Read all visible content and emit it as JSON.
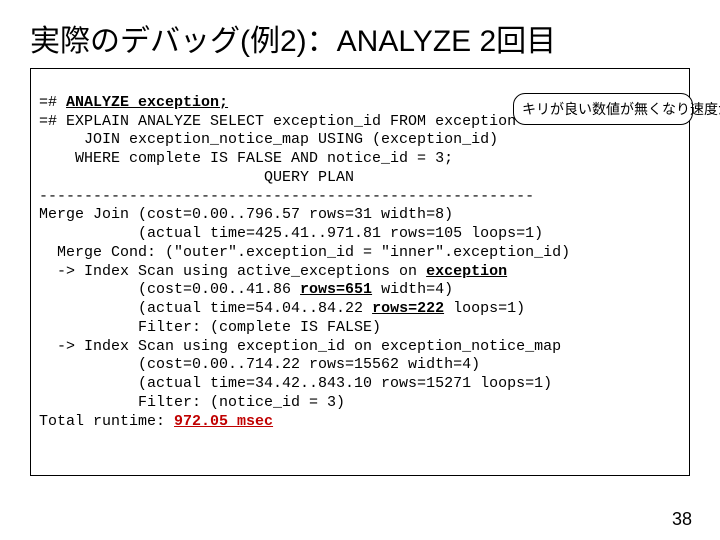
{
  "title": "実際のデバッグ(例2)：ANALYZE 2回目",
  "code": {
    "l1a": "=# ",
    "l1b": "ANALYZE exception;",
    "l2": "=# EXPLAIN ANALYZE SELECT exception_id FROM exception",
    "l3": "     JOIN exception_notice_map USING (exception_id)",
    "l4": "    WHERE complete IS FALSE AND notice_id = 3;",
    "l5": "                         QUERY PLAN",
    "l6": "-------------------------------------------------------",
    "l7": "Merge Join (cost=0.00..796.57 rows=31 width=8)",
    "l8": "           (actual time=425.41..971.81 rows=105 loops=1)",
    "l9": "  Merge Cond: (\"outer\".exception_id = \"inner\".exception_id)",
    "l10a": "  -> Index Scan using active_exceptions on ",
    "l10b": "exception",
    "l11a": "           (cost=0.00..41.86 ",
    "l11b": "rows=651",
    "l11c": " width=4)",
    "l12a": "           (actual time=54.04..84.22 ",
    "l12b": "rows=222",
    "l12c": " loops=1)",
    "l13": "           Filter: (complete IS FALSE)",
    "l14": "  -> Index Scan using exception_id on exception_notice_map",
    "l15": "           (cost=0.00..714.22 rows=15562 width=4)",
    "l16": "           (actual time=34.42..843.10 rows=15271 loops=1)",
    "l17": "           Filter: (notice_id = 3)",
    "l18a": "Total runtime: ",
    "l18b": "972.05 msec"
  },
  "callout": "キリが良い数値が無くなり速度が改善。ただし、見積の誤差が増加した理由は謎...",
  "page": "38"
}
